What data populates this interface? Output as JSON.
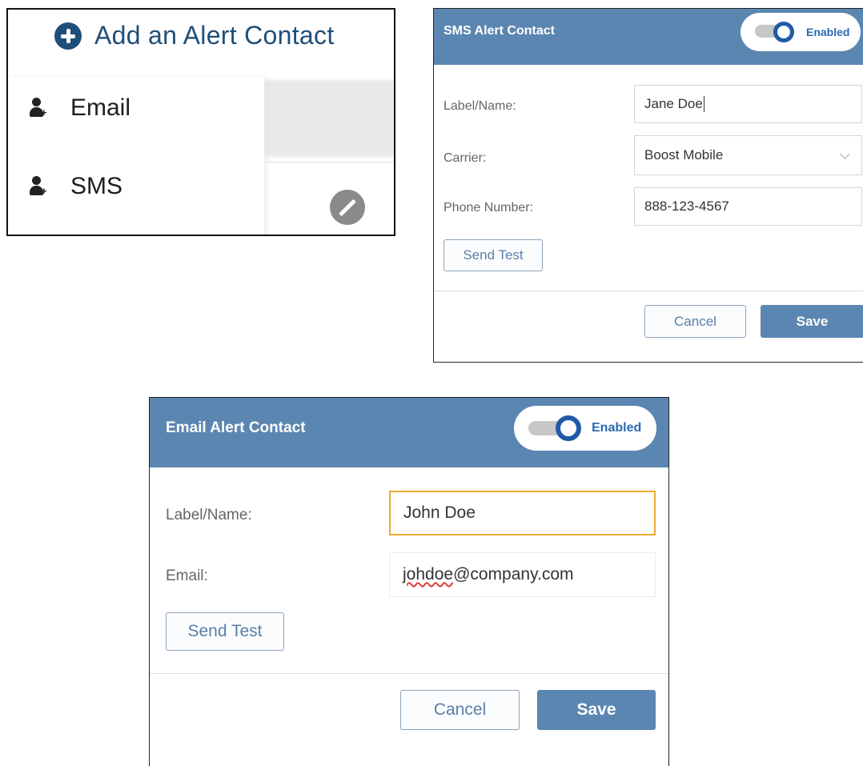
{
  "menu": {
    "title": "Add an Alert Contact",
    "items": [
      {
        "label": "Email",
        "icon": "add-person-icon"
      },
      {
        "label": "SMS",
        "icon": "add-person-icon"
      }
    ]
  },
  "sms_modal": {
    "title": "SMS Alert Contact",
    "toggle_label": "Enabled",
    "fields": {
      "label_name": {
        "label": "Label/Name:",
        "value": "Jane Doe"
      },
      "carrier": {
        "label": "Carrier:",
        "value": "Boost Mobile"
      },
      "phone": {
        "label": "Phone Number:",
        "value": "888-123-4567"
      }
    },
    "send_test": "Send Test",
    "cancel": "Cancel",
    "save": "Save"
  },
  "email_modal": {
    "title": "Email Alert Contact",
    "toggle_label": "Enabled",
    "fields": {
      "label_name": {
        "label": "Label/Name:",
        "value": "John Doe"
      },
      "email": {
        "label": "Email:",
        "value_misspelled": "johdoe",
        "value_rest": "@company.com"
      }
    },
    "send_test": "Send Test",
    "cancel": "Cancel",
    "save": "Save"
  },
  "colors": {
    "header_blue": "#5b86b1",
    "title_navy": "#1f4e7a",
    "toggle_blue": "#1f5aa8",
    "focus_orange": "#f0a830"
  }
}
